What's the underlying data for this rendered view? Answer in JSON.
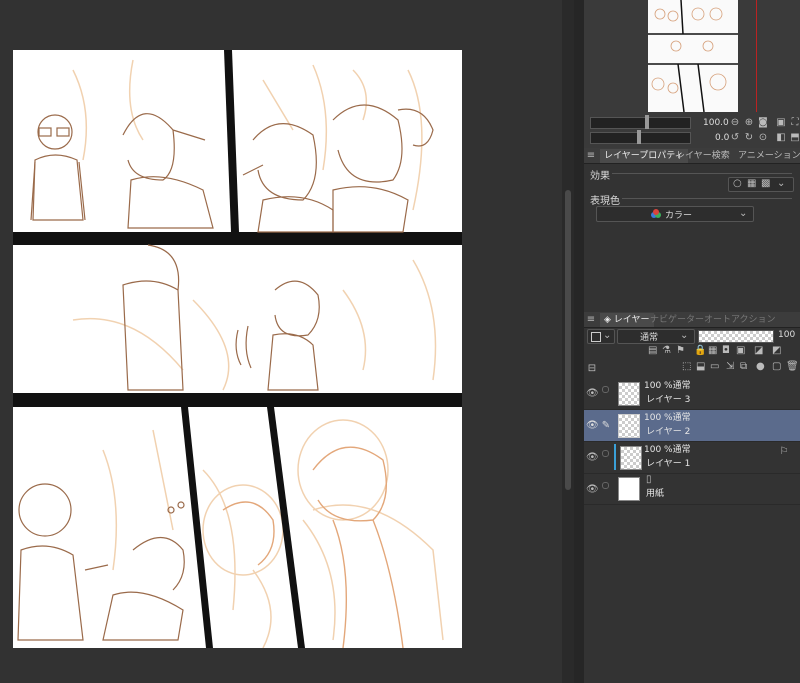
{
  "navigator": {
    "zoom_value": "100.0",
    "rotate_value": "0.0"
  },
  "layer_property": {
    "tabs": [
      "レイヤープロパティ",
      "レイヤー検索",
      "アニメーションセル"
    ],
    "effect_label": "効果",
    "expression_color_label": "表現色",
    "expression_color_value": "カラー"
  },
  "layer_panel": {
    "tabs": [
      "レイヤー",
      "ナビゲーター",
      "オートアクション"
    ],
    "blend_mode": "通常",
    "opacity": "100",
    "layers": [
      {
        "mode": "100 %通常",
        "name": "レイヤー 3",
        "selected": false
      },
      {
        "mode": "100 %通常",
        "name": "レイヤー 2",
        "selected": true
      },
      {
        "mode": "100 %通常",
        "name": "レイヤー 1",
        "selected": false
      },
      {
        "mode": "",
        "name": "用紙",
        "selected": false
      }
    ]
  },
  "colors": {
    "sketch_line": "#e8b48a",
    "ink_line": "#9a6a4a",
    "selected_layer": "#5b6b8c",
    "panel_bg": "#333333"
  }
}
